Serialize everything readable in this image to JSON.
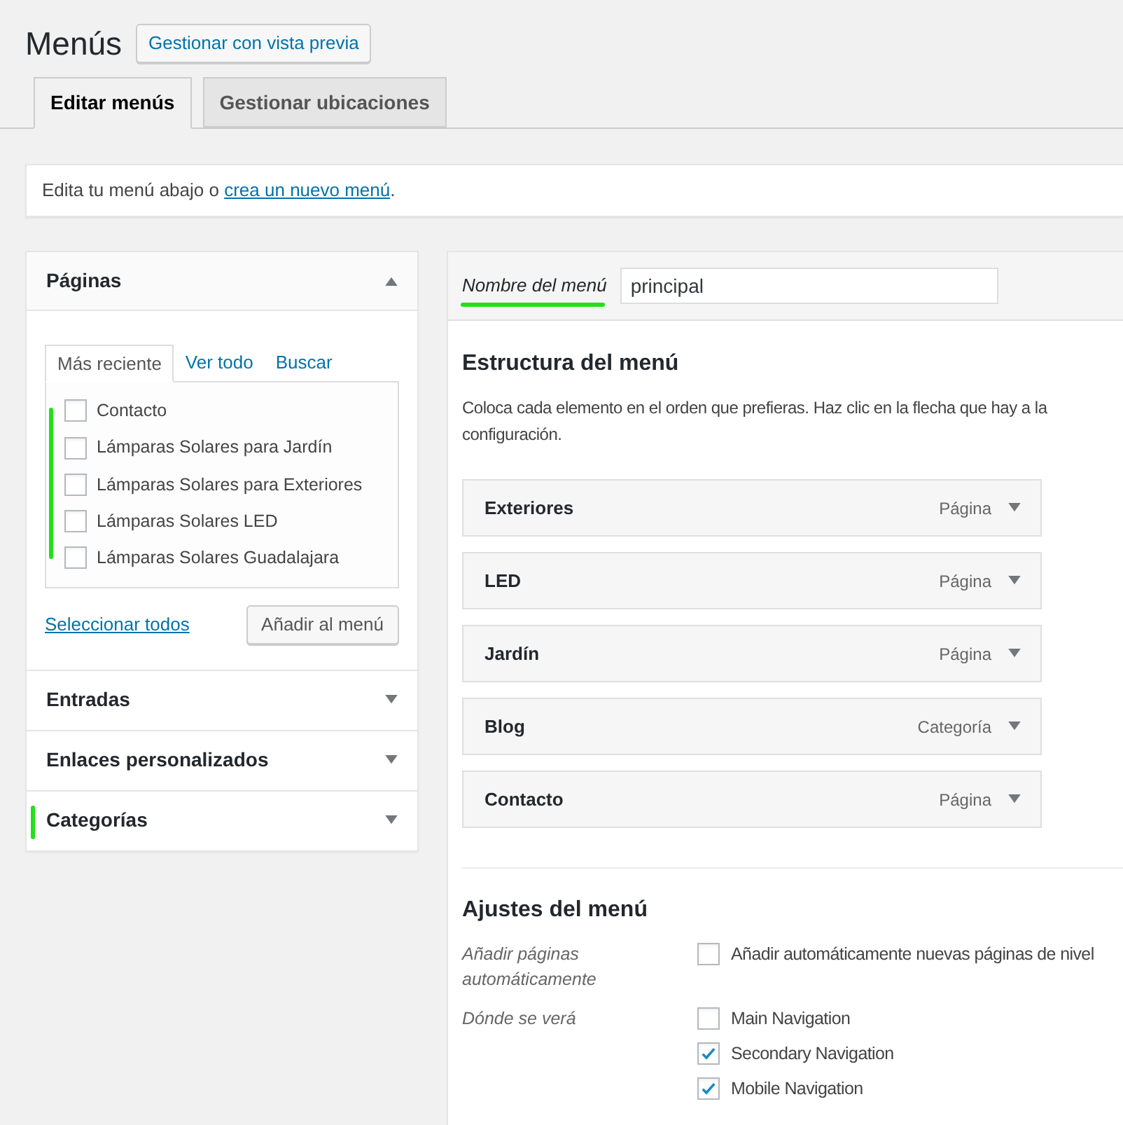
{
  "page_title": "Menús",
  "preview_button": "Gestionar con vista previa",
  "tabs": [
    {
      "label": "Editar menús",
      "selected": true
    },
    {
      "label": "Gestionar ubicaciones",
      "selected": false
    }
  ],
  "notice": {
    "text": "Edita tu menú abajo o ",
    "link": "crea un nuevo menú",
    "end": "."
  },
  "sidebar": {
    "sections": [
      {
        "title": "Páginas",
        "expanded": true,
        "marked": true,
        "tabs": [
          {
            "label": "Más reciente",
            "selected": true
          },
          {
            "label": "Ver todo",
            "selected": false
          },
          {
            "label": "Buscar",
            "selected": false
          }
        ],
        "items": [
          {
            "label": "Contacto",
            "checked": false
          },
          {
            "label": "Lámparas Solares para Jardín",
            "checked": false
          },
          {
            "label": "Lámparas Solares para Exteriores",
            "checked": false
          },
          {
            "label": "Lámparas Solares LED",
            "checked": false
          },
          {
            "label": "Lámparas Solares Guadalajara",
            "checked": false
          }
        ],
        "select_all": "Seleccionar todos",
        "add_button": "Añadir al menú"
      },
      {
        "title": "Entradas",
        "expanded": false,
        "marked": false
      },
      {
        "title": "Enlaces personalizados",
        "expanded": false,
        "marked": false
      },
      {
        "title": "Categorías",
        "expanded": false,
        "marked": true
      }
    ]
  },
  "editor": {
    "name_label": "Nombre del menú",
    "name_value": "principal",
    "structure_title": "Estructura del menú",
    "structure_help": "Coloca cada elemento en el orden que prefieras. Haz clic en la flecha que hay a la\nconfiguración.",
    "menu_items": [
      {
        "label": "Exteriores",
        "type": "Página"
      },
      {
        "label": "LED",
        "type": "Página"
      },
      {
        "label": "Jardín",
        "type": "Página"
      },
      {
        "label": "Blog",
        "type": "Categoría"
      },
      {
        "label": "Contacto",
        "type": "Página"
      }
    ],
    "settings_title": "Ajustes del menú",
    "settings": [
      {
        "label": "Añadir páginas automáticamente",
        "options": [
          {
            "label": "Añadir automáticamente nuevas páginas de nivel",
            "checked": false
          }
        ]
      },
      {
        "label": "Dónde se verá",
        "options": [
          {
            "label": "Main Navigation",
            "checked": false
          },
          {
            "label": "Secondary Navigation",
            "checked": true
          },
          {
            "label": "Mobile Navigation",
            "checked": true
          }
        ]
      }
    ]
  }
}
